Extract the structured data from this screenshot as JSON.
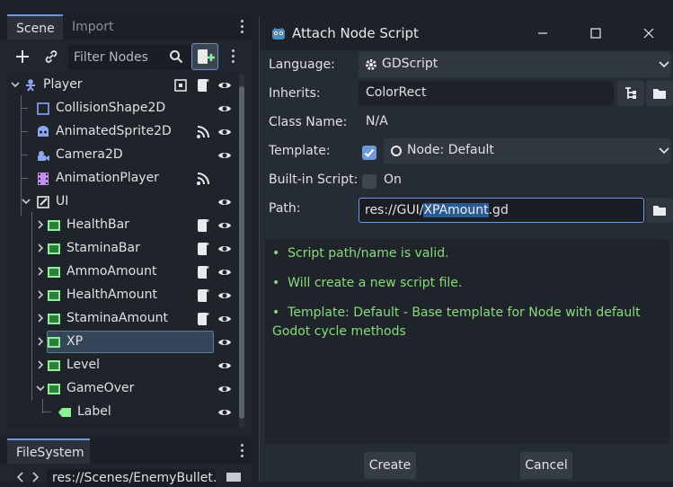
{
  "scene_dock": {
    "tabs": [
      "Scene",
      "Import"
    ],
    "filter_placeholder": "Filter Nodes",
    "nodes": [
      {
        "label": "Player",
        "icon": "player-icon",
        "depth": 0
      },
      {
        "label": "CollisionShape2D",
        "icon": "collision-shape-icon",
        "depth": 1
      },
      {
        "label": "AnimatedSprite2D",
        "icon": "animated-sprite-icon",
        "depth": 1
      },
      {
        "label": "Camera2D",
        "icon": "camera-icon",
        "depth": 1
      },
      {
        "label": "AnimationPlayer",
        "icon": "animation-player-icon",
        "depth": 1
      },
      {
        "label": "UI",
        "icon": "control-icon",
        "depth": 1
      },
      {
        "label": "HealthBar",
        "icon": "color-rect-icon",
        "depth": 2
      },
      {
        "label": "StaminaBar",
        "icon": "color-rect-icon",
        "depth": 2
      },
      {
        "label": "AmmoAmount",
        "icon": "color-rect-icon",
        "depth": 2
      },
      {
        "label": "HealthAmount",
        "icon": "color-rect-icon",
        "depth": 2
      },
      {
        "label": "StaminaAmount",
        "icon": "color-rect-icon",
        "depth": 2
      },
      {
        "label": "XP",
        "icon": "color-rect-icon",
        "depth": 2
      },
      {
        "label": "Level",
        "icon": "color-rect-icon",
        "depth": 2
      },
      {
        "label": "GameOver",
        "icon": "color-rect-icon",
        "depth": 2
      },
      {
        "label": "Label",
        "icon": "label-icon",
        "depth": 3
      }
    ]
  },
  "filesystem_dock": {
    "tab": "FileSystem",
    "path": "res://Scenes/EnemyBullet.t"
  },
  "dialog": {
    "title": "Attach Node Script",
    "language_label": "Language:",
    "language_value": "GDScript",
    "inherits_label": "Inherits:",
    "inherits_value": "ColorRect",
    "class_name_label": "Class Name:",
    "class_name_value": "N/A",
    "template_label": "Template:",
    "template_value": "Node: Default",
    "builtin_label": "Built-in Script:",
    "builtin_value": "On",
    "path_label": "Path:",
    "path_prefix": "res://GUI/",
    "path_selected": "XPAmount",
    "path_suffix": ".gd",
    "messages": [
      "Script path/name is valid.",
      "Will create a new script file.",
      "Template: Default - Base template for Node with default Godot cycle methods"
    ],
    "bullet": "•",
    "create_label": "Create",
    "cancel_label": "Cancel"
  },
  "colors": {
    "accent": "#6e9ad8",
    "success_text": "#88db7a",
    "color_rect_icon": "#8eef97"
  }
}
